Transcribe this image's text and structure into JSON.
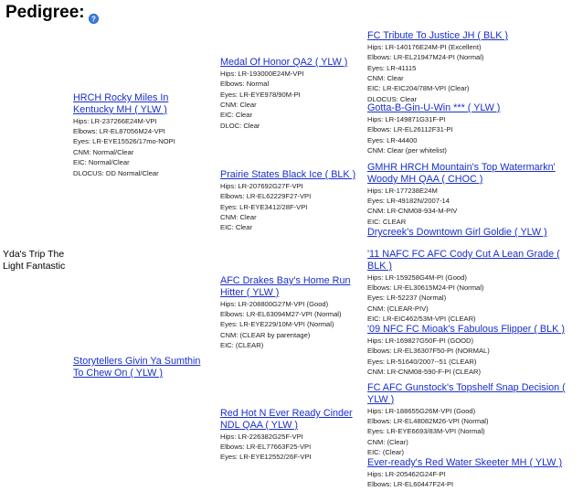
{
  "page": {
    "title": "Pedigree:",
    "help_icon": "question-circle-icon",
    "link_color": "#1a2fcb"
  },
  "subject": {
    "line1": "Yda's Trip The",
    "line2": "Light Fantastic"
  },
  "gen1": [
    {
      "name": "HRCH Rocky Miles In Kentucky MH ( YLW )",
      "info": [
        "Hips: LR-237266E24M-VPI",
        "Elbows: LR-EL87056M24-VPI",
        "Eyes: LR-EYE15526/17mo-NOPI",
        "CNM: Normal/Clear",
        "EIC: Normal/Clear",
        "DLOCUS: DD Normal/Clear"
      ]
    },
    {
      "name": "Storytellers Givin Ya Sumthin To Chew On ( YLW )",
      "info": []
    }
  ],
  "gen2": [
    {
      "name": "Medal Of Honor QA2 ( YLW )",
      "info": [
        "Hips: LR-193000E24M-VPI",
        "Elbows: Normal",
        "Eyes: LR-EYE978/90M-PI",
        "CNM: Clear",
        "EIC: Clear",
        "DLOC: Clear"
      ]
    },
    {
      "name": "Prairie States Black Ice ( BLK )",
      "info": [
        "Hips: LR-207692G27F-VPI",
        "Elbows: LR-EL62229F27-VPI",
        "Eyes: LR-EYE3412/28F-VPI",
        "CNM: Clear",
        "EIC: Clear"
      ]
    },
    {
      "name": "AFC Drakes Bay's Home Run Hitter ( YLW )",
      "info": [
        "Hips: LR-208800G27M-VPI (Good)",
        "Elbows: LR-EL63094M27-VPI (Normal)",
        "Eyes: LR-EYE229/10M-VPI (Normal)",
        "CNM: (CLEAR by parentage)",
        "EIC: (CLEAR)"
      ]
    },
    {
      "name": "Red Hot N Ever Ready Cinder NDL QAA ( YLW )",
      "info": [
        "Hips: LR-226382G25F-VPI",
        "Elbows: LR-EL77663F25-VPI",
        "Eyes: LR-EYE12552/26F-VPI"
      ]
    }
  ],
  "gen3": [
    {
      "name": "FC Tribute To Justice JH ( BLK )",
      "info": [
        "Hips: LR-140176E24M-PI (Excellent)",
        "Elbows: LR-EL21947M24-PI (Normal)",
        "Eyes: LR-41115",
        "CNM: Clear",
        "EIC: LR-EIC204/78M-VPI (Clear)",
        "DLOCUS: Clear"
      ]
    },
    {
      "name": "Gotta-B-Gin-U-Win *** ( YLW )",
      "info": [
        "Hips: LR-149871G31F-PI",
        "Elbows: LR-EL26112F31-PI",
        "Eyes: LR-44400",
        "CNM: Clear (per whitelist)"
      ]
    },
    {
      "name": "GMHR HRCH Mountain's Top Watermarkn' Woody MH QAA ( CHOC )",
      "info": [
        "Hips: LR-177238E24M",
        "Eyes: LR-49182N/2007-14",
        "CNM: LR-CNM08-934-M-PIV",
        "EIC: CLEAR"
      ]
    },
    {
      "name": "Drycreek's Downtown Girl Goldie ( YLW )",
      "info": []
    },
    {
      "name": "'11 NAFC FC AFC Cody Cut A Lean Grade ( BLK )",
      "info": [
        "Hips: LR-159258G4M-PI (Good)",
        "Elbows: LR-EL30615M24-PI (Normal)",
        "Eyes: LR-52237 (Normal)",
        "CNM: (CLEAR-PIV)",
        "EIC: LR-EIC462/53M-VPI (CLEAR)"
      ]
    },
    {
      "name": "'09 NFC FC Mioak's Fabulous Flipper ( BLK )",
      "info": [
        "Hips: LR-169827G50F-PI (GOOD)",
        "Elbows: LR-EL36307F50-PI (NORMAL)",
        "Eyes: LR-51640/2007--51 (CLEAR)",
        "CNM: LR-CNM08-590-F-PI (CLEAR)"
      ]
    },
    {
      "name": "FC AFC Gunstock's Topshelf Snap Decision ( YLW )",
      "info": [
        "Hips: LR-188655G26M-VPI (Good)",
        "Elbows: LR-EL48082M26-VPI (Normal)",
        "Eyes: LR-EYE6693/83M-VPI (Normal)",
        "CNM: (Clear)",
        "EIC: (Clear)"
      ]
    },
    {
      "name": "Ever-ready's Red Water Skeeter MH ( YLW )",
      "info": [
        "Hips: LR-205462G24F-PI",
        "Elbows: LR-EL60447F24-PI"
      ]
    }
  ]
}
